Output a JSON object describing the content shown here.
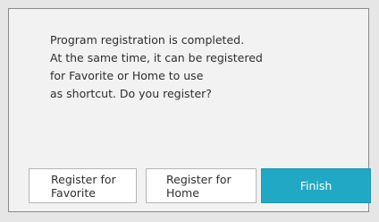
{
  "dialog": {
    "message_lines": [
      "Program registration is completed.",
      "At the same time, it can be registered",
      "for Favorite or Home to use",
      "as shortcut. Do you register?"
    ]
  },
  "buttons": {
    "register_favorite": [
      "Register for",
      "Favorite"
    ],
    "register_home": [
      "Register for",
      "Home"
    ],
    "finish": "Finish"
  },
  "colors": {
    "finish_button": "#21a8c5",
    "dialog_background": "#f2f2f2",
    "screen_background": "#e6e6e6"
  }
}
